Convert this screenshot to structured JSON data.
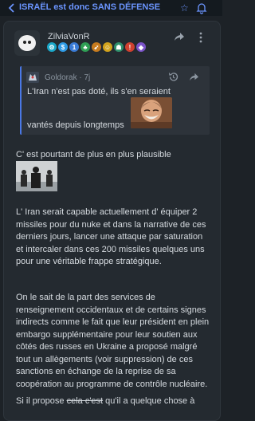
{
  "topbar": {
    "title": "ISRAËL est donc SANS DÉFENSE",
    "back_icon": "chevron-left-icon",
    "star_icon": "star-icon",
    "bell_icon": "bell-icon",
    "accent": "#6b95ff"
  },
  "post": {
    "author": "ZilviaVonR",
    "badges": [
      {
        "icon": "gear-badge-icon",
        "color": "#1aa7c8",
        "glyph": "⚙"
      },
      {
        "icon": "dollar-badge-icon",
        "color": "#2e9be6",
        "glyph": "$"
      },
      {
        "icon": "number-one-badge-icon",
        "color": "#3a7bd5",
        "glyph": "1"
      },
      {
        "icon": "tree-badge-icon",
        "color": "#2f9e54",
        "glyph": "♣"
      },
      {
        "icon": "rocket-badge-icon",
        "color": "#c77b1e",
        "glyph": "➶"
      },
      {
        "icon": "smiley-badge-icon",
        "color": "#d2a21c",
        "glyph": "☺"
      },
      {
        "icon": "robot-badge-icon",
        "color": "#2f8f6b",
        "glyph": "☗"
      },
      {
        "icon": "alert-badge-icon",
        "color": "#d0402f",
        "glyph": "!"
      },
      {
        "icon": "diamond-badge-icon",
        "color": "#7a52c8",
        "glyph": "◆"
      }
    ],
    "quote": {
      "author": "Goldorak",
      "age": "7j",
      "line1": "L'Iran n'est pas doté, ils s'en seraient",
      "line2": "vantés depuis longtemps"
    },
    "p1": "C' est pourtant de plus en plus plausible",
    "p2": "L' Iran serait capable actuellement d' équiper 2 missiles pour du nuke et dans la narrative de ces derniers jours, lancer une attaque par saturation et intercaler dans ces 200 missiles quelques uns pour une véritable frappe stratégique.",
    "p3": "On le sait de la part des services de renseignement occidentaux et de certains signes indirects comme le fait que leur président en plein embargo supplémentaire pour leur soutien aux côtés des russes en Ukraine a proposé malgré tout un allègements (voir suppression) de ces sanctions en échange de la reprise de sa coopération au programme de contrôle nucléaire.",
    "p4_start": "Si il propose ",
    "p4_strike": "cela c'est",
    "p4_end": " qu'il a quelque chose à"
  }
}
